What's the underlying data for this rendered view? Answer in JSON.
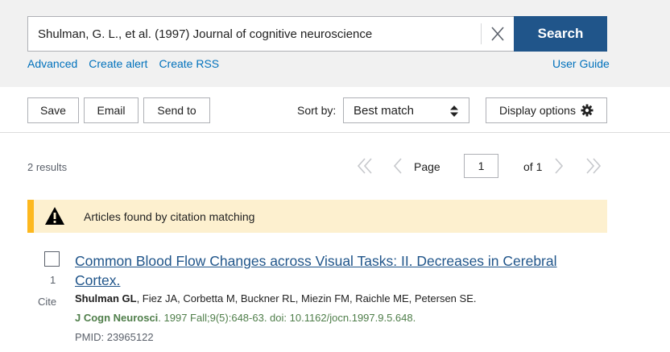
{
  "search": {
    "query": "Shulman, G. L., et al. (1997) Journal of cognitive neuroscience",
    "button_label": "Search",
    "links": [
      "Advanced",
      "Create alert",
      "Create RSS"
    ],
    "user_guide": "User Guide"
  },
  "toolbar": {
    "save_label": "Save",
    "email_label": "Email",
    "send_to_label": "Send to",
    "sort_label": "Sort by:",
    "sort_value": "Best match",
    "display_options_label": "Display options"
  },
  "pagination": {
    "results_count": "2 results",
    "page_label": "Page",
    "current_page": "1",
    "of_label": "of 1"
  },
  "alert": {
    "text": "Articles found by citation matching"
  },
  "result": {
    "number": "1",
    "cite_label": "Cite",
    "title": "Common Blood Flow Changes across Visual Tasks: II. Decreases in Cerebral Cortex.",
    "first_author": "Shulman GL",
    "other_authors": ", Fiez JA, Corbetta M, Buckner RL, Miezin FM, Raichle ME, Petersen SE.",
    "journal": "J Cogn Neurosci",
    "citation": ". 1997 Fall;9(5):648-63. doi: 10.1162/jocn.1997.9.5.648.",
    "pmid": "PMID: 23965122"
  },
  "colors": {
    "primary": "#20558a",
    "link": "#0071bc",
    "alert_bg": "#fdf0cf",
    "alert_bar": "#fdb81e",
    "journal": "#4f7e4a"
  },
  "icons": [
    "clear-icon",
    "sort-arrows-icon",
    "gear-icon",
    "first-page-icon",
    "prev-page-icon",
    "next-page-icon",
    "last-page-icon",
    "warning-icon"
  ]
}
